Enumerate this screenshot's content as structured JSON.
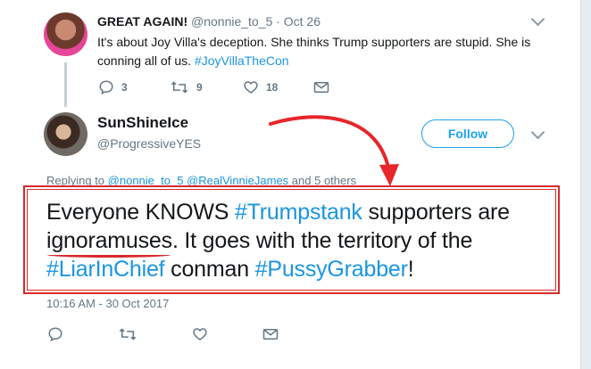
{
  "tweet1": {
    "display_name": "GREAT AGAIN!",
    "handle": "@nonnie_to_5",
    "separator": " · ",
    "date": "Oct 26",
    "text_part1": "It's about Joy Villa's deception.  She thinks Trump supporters are stupid. She is conning all of us. ",
    "hashtag": "#JoyVillaTheCon",
    "actions": {
      "reply_count": "3",
      "retweet_count": "9",
      "like_count": "18"
    }
  },
  "tweet2": {
    "display_name": "SunShineIce",
    "handle": "@ProgressiveYES",
    "follow_label": "Follow",
    "replying_prefix": "Replying to ",
    "replying_user1": "@nonnie_to_5",
    "replying_user2": "@RealVinnieJames",
    "replying_suffix": " and 5 others",
    "text": {
      "p1": "Everyone KNOWS ",
      "h1": "#Trumpstank",
      "p2": " supporters are ",
      "underlined": "ignoramuses",
      "p3": ". It goes with the territory of the ",
      "h2": "#LiarInChief",
      "p4": " conman ",
      "h3": "#PussyGrabber",
      "p5": "!"
    },
    "timestamp": "10:16 AM - 30 Oct 2017"
  },
  "icons": {
    "reply": "reply-icon",
    "retweet": "retweet-icon",
    "like": "heart-icon",
    "message": "envelope-icon",
    "more": "chevron-down-icon"
  },
  "colors": {
    "link_blue": "#1b95e0",
    "follow_blue": "#1da1f2",
    "annotation_red": "#d8292b",
    "secondary_text": "#657786"
  }
}
